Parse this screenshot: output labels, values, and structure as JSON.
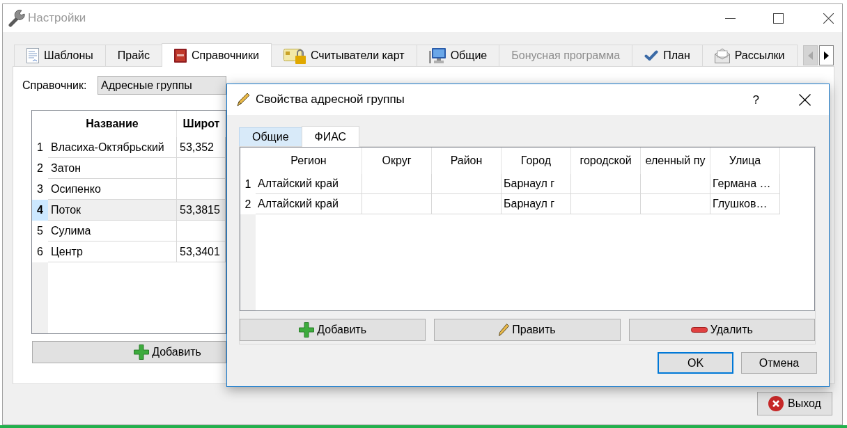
{
  "window": {
    "title": "Настройки",
    "active": false
  },
  "tabs": [
    {
      "label": "Шаблоны",
      "selected": false,
      "disabled": false
    },
    {
      "label": "Прайс",
      "selected": false,
      "disabled": false
    },
    {
      "label": "Справочники",
      "selected": true,
      "disabled": false
    },
    {
      "label": "Считыватели карт",
      "selected": false,
      "disabled": false
    },
    {
      "label": "Общие",
      "selected": false,
      "disabled": false
    },
    {
      "label": "Бонусная программа",
      "selected": false,
      "disabled": true
    },
    {
      "label": "План",
      "selected": false,
      "disabled": false
    },
    {
      "label": "Рассылки",
      "selected": false,
      "disabled": false
    }
  ],
  "tab_scroll_buttons": [
    {
      "kind": "left",
      "disabled": true
    },
    {
      "kind": "right",
      "disabled": false
    }
  ],
  "directory": {
    "label": "Справочник:",
    "value": "Адресные группы"
  },
  "directory_table": {
    "columns": [
      "Название",
      "Широт"
    ],
    "rows": [
      {
        "number": "1",
        "name": "Власиха-Октябрьский",
        "column_2": "53,352",
        "selected": false
      },
      {
        "number": "2",
        "name": "Затон",
        "selected": false
      },
      {
        "number": "3",
        "name": "Осипенко",
        "selected": false
      },
      {
        "number": "4",
        "name": "Поток",
        "column_2": "53,3815",
        "selected": true
      },
      {
        "number": "5",
        "name": "Сулима",
        "selected": false
      },
      {
        "number": "6",
        "name": "Центр",
        "column_2": "53,3401",
        "selected": false
      }
    ]
  },
  "add_button": {
    "label": "Добавить"
  },
  "exit_button": {
    "label": "Выход"
  },
  "dialog": {
    "title": "Свойства адресной группы",
    "help": "?",
    "tabs": [
      {
        "label": "Общие",
        "selected": false,
        "hovered": true
      },
      {
        "label": "ФИАС",
        "selected": true,
        "hovered": false
      }
    ],
    "table": {
      "columns": [
        "Регион",
        "Округ",
        "Район",
        "Город",
        "городской",
        "еленный пу",
        "Улица"
      ],
      "rows": [
        {
          "number": "1",
          "region": "Алтайский край",
          "city": "Барнаул г",
          "street": "Германа …"
        },
        {
          "number": "2",
          "region": "Алтайский край",
          "city": "Барнаул г",
          "street": "Глушков…"
        }
      ]
    },
    "row_buttons": [
      {
        "kind": "add",
        "label": "Добавить"
      },
      {
        "kind": "edit",
        "label": "Править"
      },
      {
        "kind": "delete",
        "label": "Удалить"
      }
    ],
    "buttons": [
      {
        "label": "OK",
        "default": true
      },
      {
        "label": "Отмена",
        "default": false
      }
    ]
  }
}
